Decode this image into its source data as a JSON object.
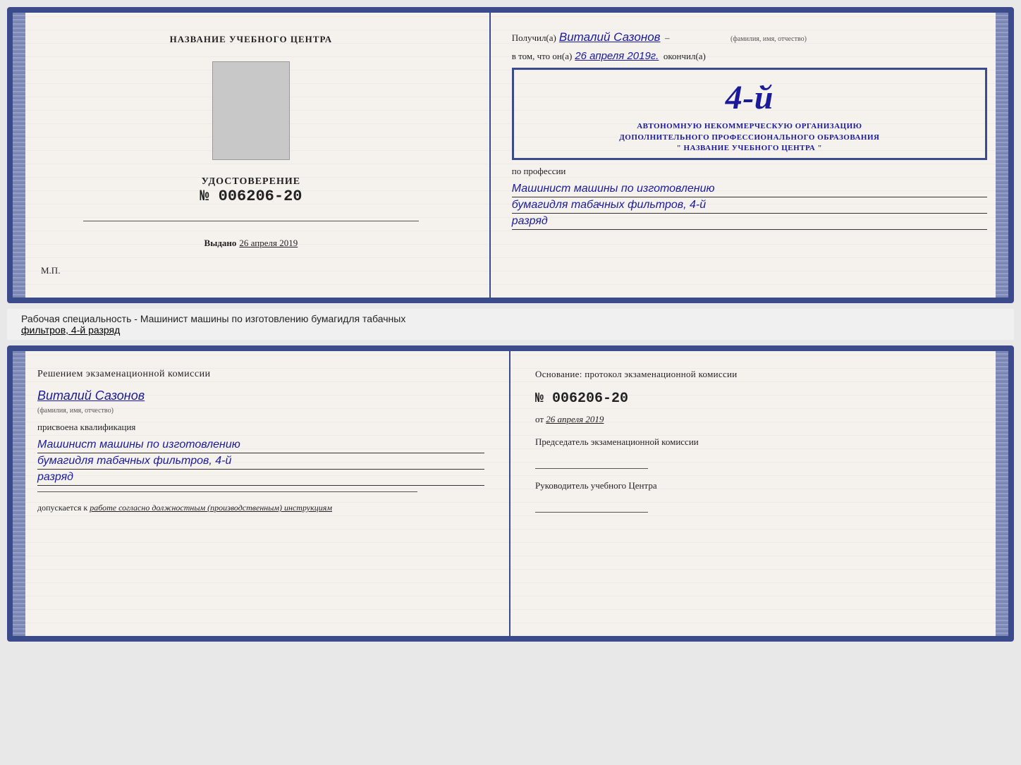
{
  "top_cert": {
    "left": {
      "header": "НАЗВАНИЕ УЧЕБНОГО ЦЕНТРА",
      "udostoverenie_title": "УДОСТОВЕРЕНИЕ",
      "udostoverenie_number": "№ 006206-20",
      "vydano_label": "Выдано",
      "vydano_date": "26 апреля 2019",
      "mp_label": "М.П."
    },
    "right": {
      "poluchil_prefix": "Получил(а)",
      "poluchil_name": "Виталий Сазонов",
      "fio_label": "(фамилия, имя, отчество)",
      "v_tom_prefix": "в том, что он(а)",
      "v_tom_date": "26 апреля 2019г.",
      "okonchil": "окончил(а)",
      "stamp_number": "4-й",
      "stamp_line1": "АВТОНОМНУЮ НЕКОММЕРЧЕСКУЮ ОРГАНИЗАЦИЮ",
      "stamp_line2": "ДОПОЛНИТЕЛЬНОГО ПРОФЕССИОНАЛЬНОГО ОБРАЗОВАНИЯ",
      "stamp_line3": "\" НАЗВАНИЕ УЧЕБНОГО ЦЕНТРА \"",
      "po_professii": "по профессии",
      "profession_line1": "Машинист машины по изготовлению",
      "profession_line2": "бумагидля табачных фильтров, 4-й",
      "profession_line3": "разряд"
    }
  },
  "middle_text": {
    "text": "Рабочая специальность - Машинист машины по изготовлению бумагидля табачных",
    "underlined": "фильтров, 4-й разряд"
  },
  "bottom_cert": {
    "left": {
      "header": "Решением  экзаменационной  комиссии",
      "name": "Виталий Сазонов",
      "fio_label": "(фамилия, имя, отчество)",
      "prisvoena": "присвоена квалификация",
      "qualification_line1": "Машинист машины по изготовлению",
      "qualification_line2": "бумагидля табачных фильтров, 4-й",
      "qualification_line3": "разряд",
      "dopuskaetsya": "допускается к",
      "dopusk_text": "работе согласно должностным (производственным) инструкциям"
    },
    "right": {
      "osnovanie": "Основание: протокол экзаменационной  комиссии",
      "number": "№  006206-20",
      "ot_label": "от",
      "ot_date": "26 апреля 2019",
      "predsedatel_title": "Председатель экзаменационной комиссии",
      "rukovoditel_title": "Руководитель учебного Центра"
    }
  }
}
